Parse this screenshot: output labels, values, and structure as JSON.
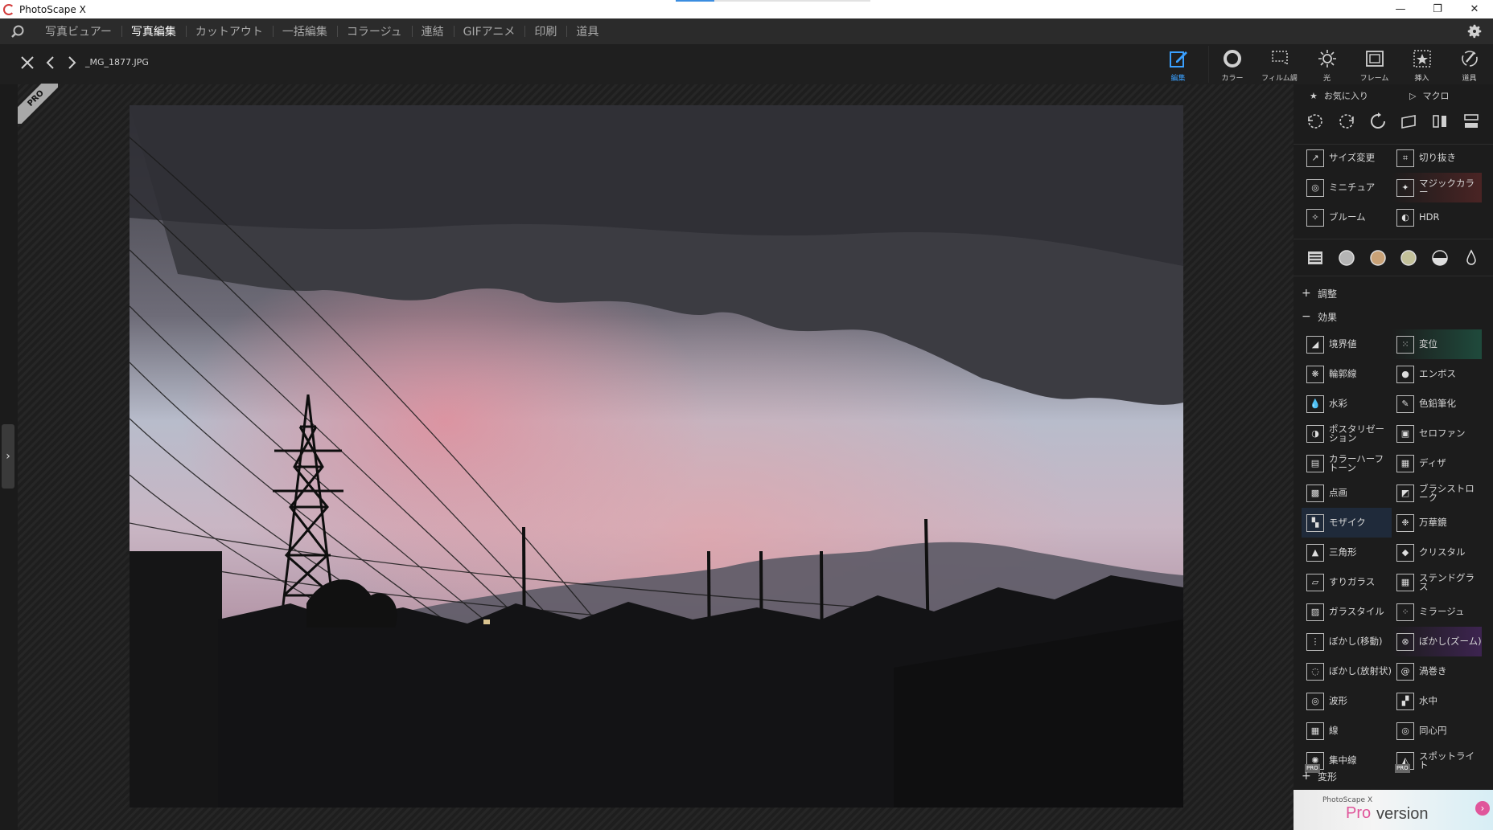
{
  "app": {
    "title": "PhotoScape X"
  },
  "window_controls": {
    "minimize": "—",
    "restore": "❐",
    "close": "✕"
  },
  "menu": {
    "items": [
      {
        "label": "写真ビュアー",
        "active": false
      },
      {
        "label": "写真編集",
        "active": true
      },
      {
        "label": "カットアウト",
        "active": false
      },
      {
        "label": "一括編集",
        "active": false
      },
      {
        "label": "コラージュ",
        "active": false
      },
      {
        "label": "連結",
        "active": false
      },
      {
        "label": "GIFアニメ",
        "active": false
      },
      {
        "label": "印刷",
        "active": false
      },
      {
        "label": "道具",
        "active": false
      }
    ]
  },
  "editor": {
    "filename": "_MG_1877.JPG",
    "badge": "PRO"
  },
  "top_tools": [
    {
      "label": "編集",
      "icon": "edit-icon",
      "active": true
    },
    {
      "label": "カラー",
      "icon": "color-icon",
      "active": false
    },
    {
      "label": "フィルム調",
      "icon": "film-icon",
      "active": false
    },
    {
      "label": "光",
      "icon": "light-icon",
      "active": false
    },
    {
      "label": "フレーム",
      "icon": "frame-icon",
      "active": false
    },
    {
      "label": "挿入",
      "icon": "insert-icon",
      "active": false
    },
    {
      "label": "道具",
      "icon": "tools-icon",
      "active": false
    }
  ],
  "panel": {
    "favorites_label": "お気に入り",
    "macro_label": "マクロ",
    "basic_tools": [
      {
        "label": "サイズ変更",
        "icon": "resize-icon",
        "highlight": ""
      },
      {
        "label": "切り抜き",
        "icon": "crop-icon",
        "highlight": ""
      },
      {
        "label": "ミニチュア",
        "icon": "miniature-icon",
        "highlight": ""
      },
      {
        "label": "マジックカラー",
        "icon": "magic-color-icon",
        "highlight": "red"
      },
      {
        "label": "ブルーム",
        "icon": "bloom-icon",
        "highlight": ""
      },
      {
        "label": "HDR",
        "icon": "hdr-icon",
        "highlight": ""
      }
    ],
    "sections": {
      "adjust": "調整",
      "effects": "効果",
      "transform": "変形"
    },
    "effects": [
      {
        "label": "境界値",
        "icon": "threshold-icon",
        "highlight": "",
        "pro": false
      },
      {
        "label": "変位",
        "icon": "displacement-icon",
        "highlight": "green",
        "pro": false
      },
      {
        "label": "輪郭線",
        "icon": "outline-icon",
        "highlight": "",
        "pro": false
      },
      {
        "label": "エンボス",
        "icon": "emboss-icon",
        "highlight": "",
        "pro": false
      },
      {
        "label": "水彩",
        "icon": "watercolor-icon",
        "highlight": "",
        "pro": false
      },
      {
        "label": "色鉛筆化",
        "icon": "color-pencil-icon",
        "highlight": "",
        "pro": false
      },
      {
        "label": "ポスタリゼーション",
        "icon": "posterize-icon",
        "highlight": "",
        "pro": false
      },
      {
        "label": "セロファン",
        "icon": "cellophane-icon",
        "highlight": "",
        "pro": false
      },
      {
        "label": "カラーハーフトーン",
        "icon": "halftone-icon",
        "highlight": "",
        "pro": false
      },
      {
        "label": "ディザ",
        "icon": "dither-icon",
        "highlight": "",
        "pro": false
      },
      {
        "label": "点画",
        "icon": "pointillism-icon",
        "highlight": "",
        "pro": false
      },
      {
        "label": "ブラシストローク",
        "icon": "brush-stroke-icon",
        "highlight": "",
        "pro": false
      },
      {
        "label": "モザイク",
        "icon": "mosaic-icon",
        "highlight": "blue",
        "pro": false
      },
      {
        "label": "万華鏡",
        "icon": "kaleidoscope-icon",
        "highlight": "",
        "pro": false
      },
      {
        "label": "三角形",
        "icon": "triangle-icon",
        "highlight": "",
        "pro": false
      },
      {
        "label": "クリスタル",
        "icon": "crystal-icon",
        "highlight": "",
        "pro": false
      },
      {
        "label": "すりガラス",
        "icon": "frosted-glass-icon",
        "highlight": "",
        "pro": false
      },
      {
        "label": "ステンドグラス",
        "icon": "stained-glass-icon",
        "highlight": "",
        "pro": false
      },
      {
        "label": "ガラスタイル",
        "icon": "glass-tile-icon",
        "highlight": "",
        "pro": false
      },
      {
        "label": "ミラージュ",
        "icon": "mirage-icon",
        "highlight": "",
        "pro": false
      },
      {
        "label": "ぼかし(移動)",
        "icon": "motion-blur-icon",
        "highlight": "",
        "pro": false
      },
      {
        "label": "ぼかし(ズーム)",
        "icon": "zoom-blur-icon",
        "highlight": "purple",
        "pro": false
      },
      {
        "label": "ぼかし(放射状)",
        "icon": "radial-blur-icon",
        "highlight": "",
        "pro": false
      },
      {
        "label": "渦巻き",
        "icon": "swirl-icon",
        "highlight": "",
        "pro": false
      },
      {
        "label": "波形",
        "icon": "wave-icon",
        "highlight": "",
        "pro": false
      },
      {
        "label": "水中",
        "icon": "underwater-icon",
        "highlight": "",
        "pro": false
      },
      {
        "label": "線",
        "icon": "lines-icon",
        "highlight": "",
        "pro": false
      },
      {
        "label": "同心円",
        "icon": "concentric-icon",
        "highlight": "",
        "pro": false
      },
      {
        "label": "集中線",
        "icon": "focus-lines-icon",
        "highlight": "",
        "pro": true
      },
      {
        "label": "スポットライト",
        "icon": "spotlight-icon",
        "highlight": "",
        "pro": true
      }
    ],
    "ad": {
      "brand": "PhotoScape X",
      "pro": "Pro",
      "version": "version",
      "arrow": "›"
    }
  },
  "colors": {
    "accent_blue": "#3aa0ff",
    "pro_pink": "#e0569b",
    "panel_bg": "#1c1c1c",
    "menu_bg": "#2b2b2b"
  }
}
